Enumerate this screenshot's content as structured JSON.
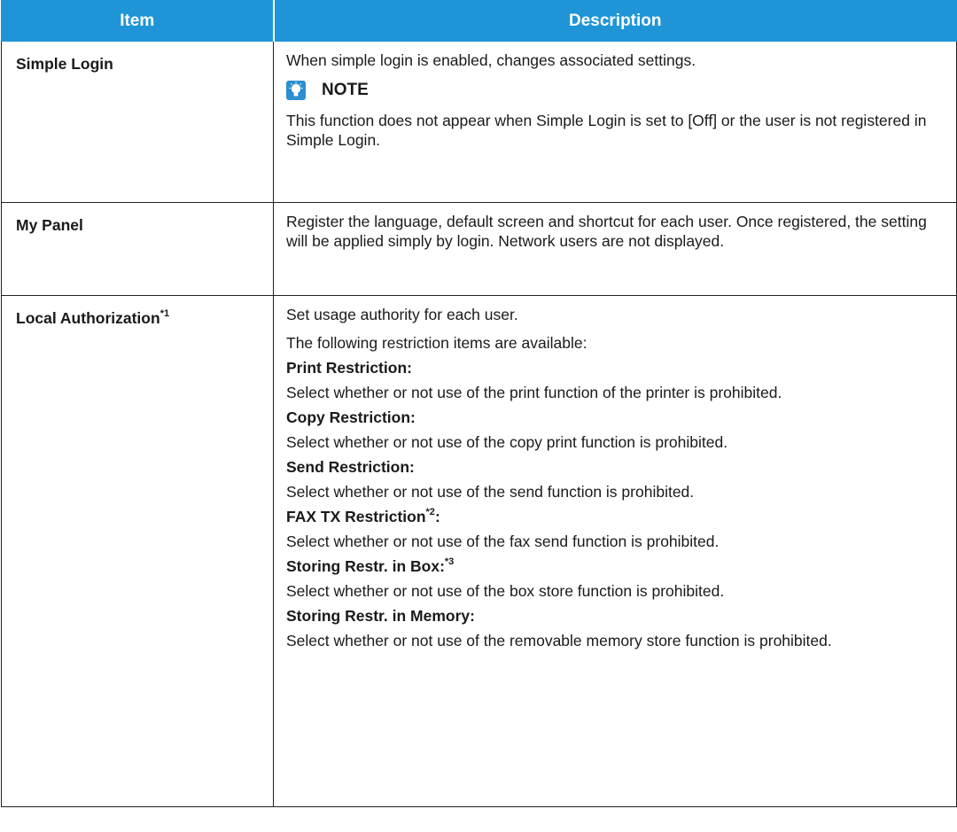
{
  "header": {
    "item": "Item",
    "description": "Description"
  },
  "rows": [
    {
      "item": "Simple Login",
      "desc": "When simple login is enabled, changes associated settings.",
      "note_label": "NOTE",
      "note_text": "This function does not appear when Simple Login is set to [Off] or the user is not registered in Simple Login."
    },
    {
      "item": "My Panel",
      "desc": "Register the language, default screen and shortcut for each user. Once registered, the setting will be applied simply by login. Network users are not displayed."
    },
    {
      "item": "Local Authorization",
      "item_sup": "*1",
      "intro1": "Set usage authority for each user.",
      "intro2": "The following restriction items are available:",
      "restrictions": [
        {
          "title": "Print Restriction:",
          "sup": "",
          "suffix": "",
          "text": "Select whether or not use of the print function of the printer is prohibited."
        },
        {
          "title": "Copy Restriction:",
          "sup": "",
          "suffix": "",
          "text": "Select whether or not use of the copy print function is prohibited."
        },
        {
          "title": "Send Restriction:",
          "sup": "",
          "suffix": "",
          "text": "Select whether or not use of the send function is prohibited."
        },
        {
          "title": "FAX TX Restriction",
          "sup": "*2",
          "suffix": ":",
          "text": "Select whether or not use of the fax send function is prohibited."
        },
        {
          "title": "Storing Restr. in Box:",
          "sup": "*3",
          "suffix": "",
          "text": "Select whether or not use of the box store function is prohibited."
        },
        {
          "title": "Storing Restr. in Memory:",
          "sup": "",
          "suffix": "",
          "text": "Select whether or not use of the removable memory store function is prohibited."
        }
      ]
    }
  ],
  "colors": {
    "header_bg": "#1f95d8",
    "header_text": "#ffffff",
    "note_icon": "#2b8fd1"
  },
  "icons": {
    "note": "lightbulb-note-icon"
  }
}
